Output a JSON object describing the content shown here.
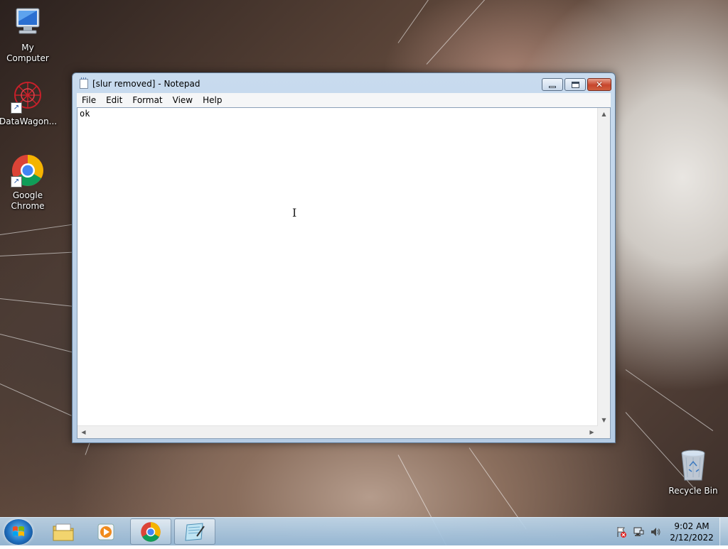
{
  "desktop": {
    "icons": [
      {
        "label": "My Computer",
        "icon": "computer-icon"
      },
      {
        "label": "DataWagon...",
        "icon": "datawagon-icon"
      },
      {
        "label": "Google Chrome",
        "icon": "chrome-icon"
      },
      {
        "label": "Recycle Bin",
        "icon": "recycle-bin-icon"
      }
    ]
  },
  "window": {
    "title": "[slur removed] - Notepad",
    "menu": [
      "File",
      "Edit",
      "Format",
      "View",
      "Help"
    ],
    "content": "ok",
    "buttons": {
      "minimize": "minimize-icon",
      "maximize": "maximize-icon",
      "close": "close-icon"
    }
  },
  "taskbar": {
    "pinned": [
      {
        "name": "start-button",
        "icon": "windows-logo-icon"
      },
      {
        "name": "explorer",
        "icon": "folder-icon"
      },
      {
        "name": "media-player",
        "icon": "media-player-icon"
      },
      {
        "name": "chrome",
        "icon": "chrome-icon"
      },
      {
        "name": "notepad",
        "icon": "notepad-icon",
        "active": true
      }
    ],
    "clock": {
      "time": "9:02 AM",
      "date": "2/12/2022"
    }
  },
  "colors": {
    "accent": "#1f6fbf",
    "close": "#c7452c",
    "window_frame": "#b4cbe4"
  }
}
